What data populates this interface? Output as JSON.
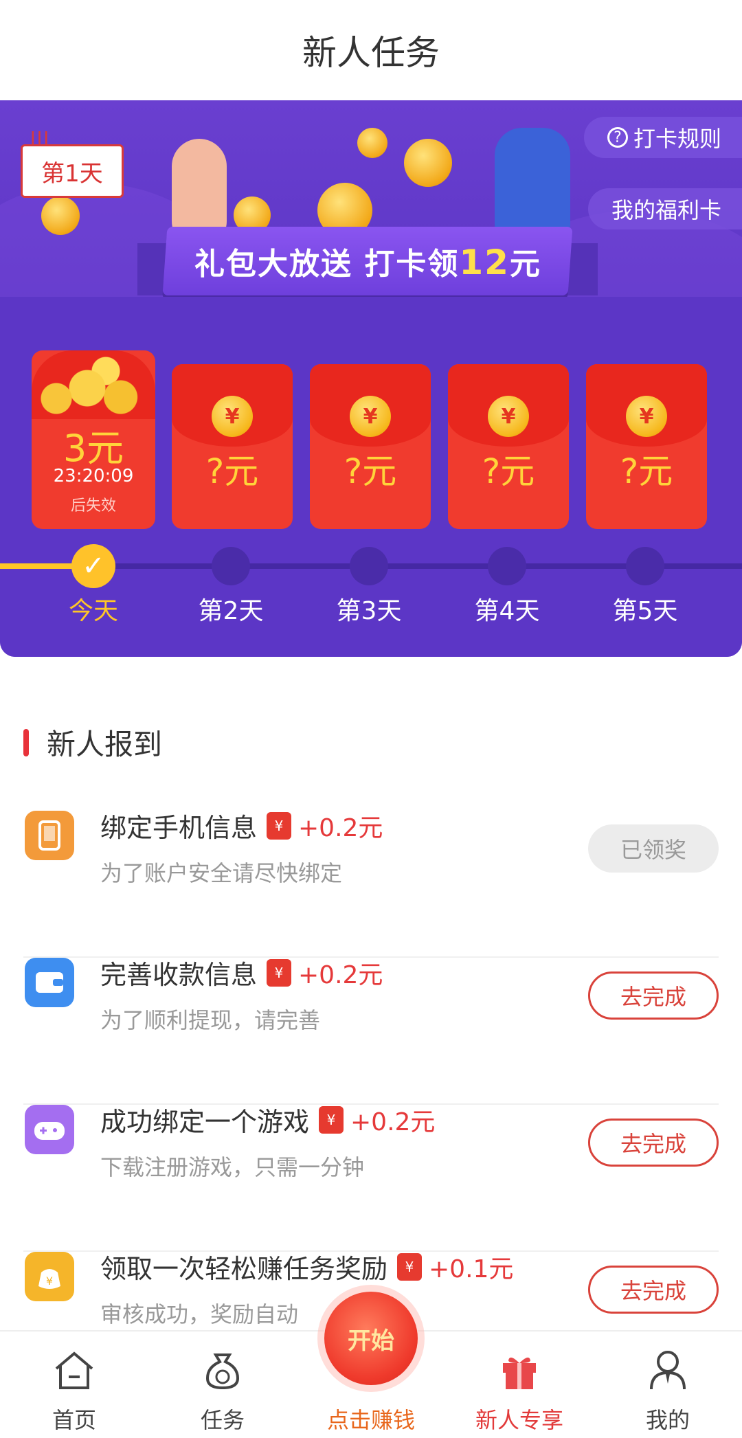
{
  "header": {
    "title": "新人任务"
  },
  "banner": {
    "day_badge": "第1天",
    "rules_button": "打卡规则",
    "welfare_button": "我的福利卡",
    "ribbon_text_a": "礼包大放送  打卡领",
    "ribbon_amount": "12",
    "ribbon_text_b": "元"
  },
  "envelopes": [
    {
      "amount": "3元",
      "timer": "23:20:09",
      "expire": "后失效"
    },
    {
      "amount": "?元"
    },
    {
      "amount": "?元"
    },
    {
      "amount": "?元"
    },
    {
      "amount": "?元"
    }
  ],
  "days": [
    "今天",
    "第2天",
    "第3天",
    "第4天",
    "第5天"
  ],
  "section": {
    "title": "新人报到"
  },
  "tasks": [
    {
      "title": "绑定手机信息",
      "reward": "+0.2元",
      "subtitle": "为了账户安全请尽快绑定",
      "button": "已领奖",
      "icon": "phone-icon",
      "color": "#f39a3a"
    },
    {
      "title": "完善收款信息",
      "reward": "+0.2元",
      "subtitle": "为了顺利提现，请完善",
      "button": "去完成",
      "icon": "wallet-icon",
      "color": "#3e8ef0"
    },
    {
      "title": "成功绑定一个游戏",
      "reward": "+0.2元",
      "subtitle": "下载注册游戏，只需一分钟",
      "button": "去完成",
      "icon": "gamepad-icon",
      "color": "#a46ef0"
    },
    {
      "title": "领取一次轻松赚任务奖励",
      "reward": "+0.1元",
      "subtitle": "审核成功，奖励自动",
      "button": "去完成",
      "icon": "money-bag-icon",
      "color": "#f5b52a"
    }
  ],
  "tabbar": {
    "items": [
      {
        "label": "首页",
        "icon": "home-icon"
      },
      {
        "label": "任务",
        "icon": "money-bag-icon"
      },
      {
        "label": "点击赚钱",
        "icon": "start-icon"
      },
      {
        "label": "新人专享",
        "icon": "gift-icon"
      },
      {
        "label": "我的",
        "icon": "user-icon"
      }
    ],
    "start_label": "开始"
  },
  "colors": {
    "purple": "#5c36c6",
    "red": "#e63a2f",
    "gold": "#ffc627",
    "accent_red": "#e5393a"
  }
}
